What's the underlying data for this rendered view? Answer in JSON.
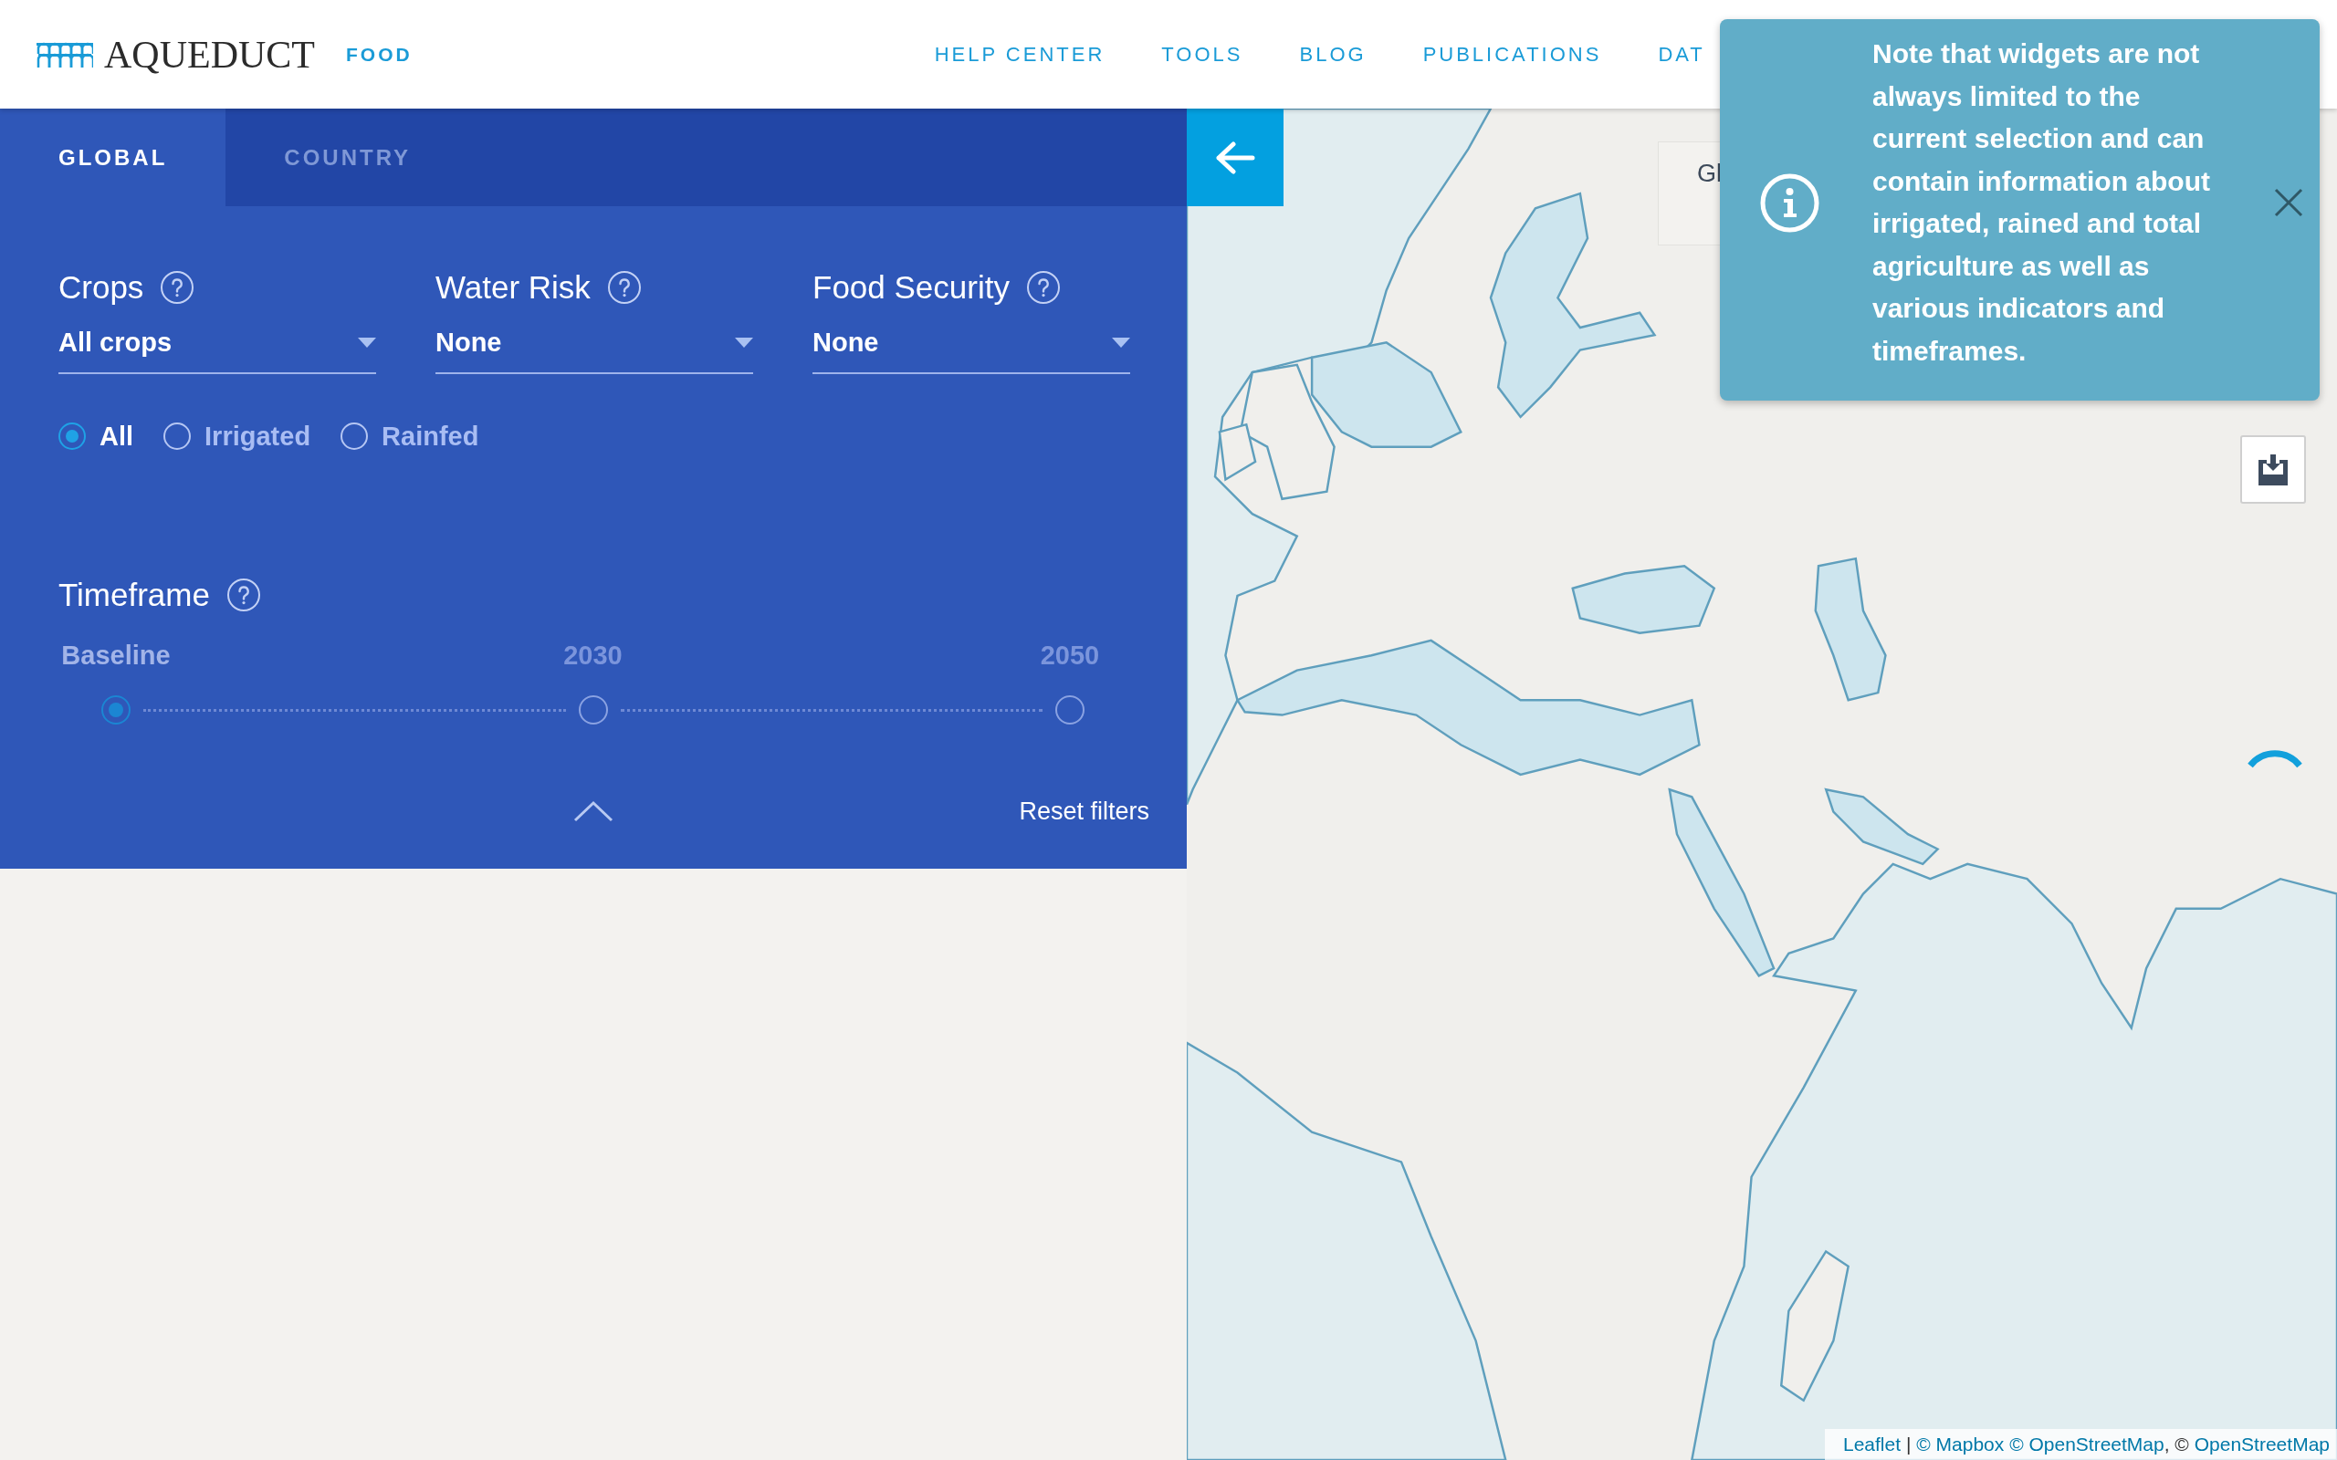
{
  "header": {
    "logo": "AQUEDUCT",
    "product": "FOOD",
    "nav": [
      "HELP CENTER",
      "TOOLS",
      "BLOG",
      "PUBLICATIONS",
      "DAT"
    ]
  },
  "tabs": [
    {
      "label": "GLOBAL",
      "selected": true
    },
    {
      "label": "COUNTRY",
      "selected": false
    }
  ],
  "filters": [
    {
      "label": "Crops",
      "value": "All crops"
    },
    {
      "label": "Water Risk",
      "value": "None"
    },
    {
      "label": "Food Security",
      "value": "None"
    }
  ],
  "irrigation": [
    {
      "label": "All",
      "selected": true
    },
    {
      "label": "Irrigated",
      "selected": false
    },
    {
      "label": "Rainfed",
      "selected": false
    }
  ],
  "timeframe": {
    "label": "Timeframe",
    "options": [
      {
        "label": "Baseline",
        "selected": true
      },
      {
        "label": "2030",
        "selected": false
      },
      {
        "label": "2050",
        "selected": false
      }
    ]
  },
  "reset": {
    "label": "Reset filters"
  },
  "map": {
    "legend_title": "Gl",
    "attribution": [
      {
        "text": "Leaflet",
        "kind": "link"
      },
      {
        "text": "|",
        "kind": "text"
      },
      {
        "text": "© Mapbox",
        "kind": "link"
      },
      {
        "text": "© OpenStreetMap",
        "kind": "link"
      },
      {
        "text": ", ©",
        "kind": "suffix"
      },
      {
        "text": "OpenStreetMap",
        "kind": "link"
      }
    ]
  },
  "tooltip": {
    "text": "Note that widgets are not always limited to the current selection and can contain information about irrigated, rained and total agriculture as well as various indicators and timeframes."
  }
}
